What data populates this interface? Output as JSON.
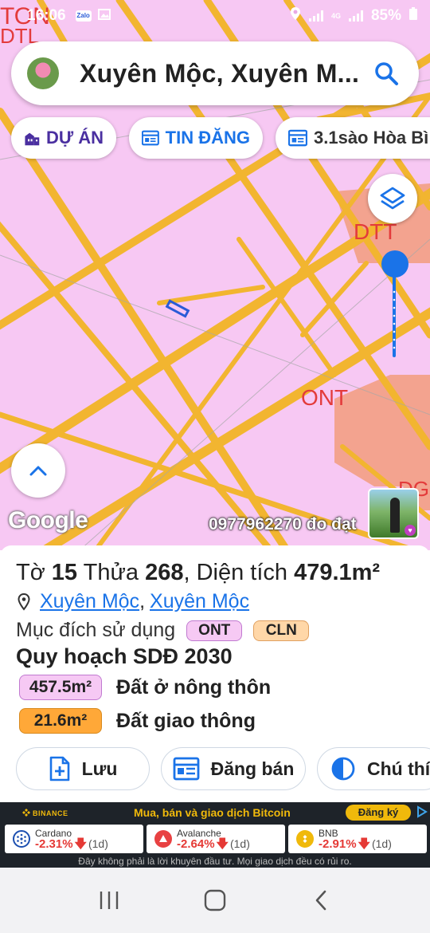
{
  "status_bar": {
    "time": "16:06",
    "app_icon_label": "Zalo",
    "network": "4G",
    "battery": "85%"
  },
  "search": {
    "title": "Xuyên Mộc, Xuyên M..."
  },
  "chips": {
    "du_an": "DỰ ÁN",
    "tin_dang": "TIN ĐĂNG",
    "sao": "3.1sào Hòa Bì"
  },
  "map": {
    "labels": [
      "TON",
      "DTL",
      "DTT",
      "ONT",
      "DG"
    ],
    "google_label": "Google",
    "phone_label": "0977962270 đo đạt"
  },
  "parcel": {
    "to_label": "Tờ",
    "to_value": "15",
    "thua_label": "Thửa",
    "thua_value": "268",
    "dien_tich_label": ", Diện tích",
    "dien_tich_value": "479.1m²",
    "location_1": "Xuyên Mộc",
    "location_sep": ",",
    "location_2": "Xuyên Mộc",
    "purpose_label": "Mục đích sử dụng",
    "tags": [
      "ONT",
      "CLN"
    ],
    "plan_title": "Quy hoạch SDĐ 2030",
    "areas": [
      {
        "value": "457.5m²",
        "label": "Đất ở nông thôn",
        "color": "#f6c9f4"
      },
      {
        "value": "21.6m²",
        "label": "Đất giao thông",
        "color": "#ffa838"
      }
    ]
  },
  "actions": {
    "luu": "Lưu",
    "dang_ban": "Đăng bán",
    "chu_thich": "Chú thí"
  },
  "ad": {
    "brand": "BINANCE",
    "headline": "Mua, bán và giao dịch Bitcoin",
    "signup": "Đăng ký",
    "coins": [
      {
        "name": "Cardano",
        "change": "-2.31%",
        "period": "(1d)",
        "color": "#1c4fb0"
      },
      {
        "name": "Avalanche",
        "change": "-2.64%",
        "period": "(1d)",
        "color": "#e84142"
      },
      {
        "name": "BNB",
        "change": "-2.91%",
        "period": "(1d)",
        "color": "#f0b90b"
      }
    ],
    "disclaimer": "Đây không phải là lời khuyên đầu tư. Mọi giao dịch đều có rủi ro."
  },
  "colors": {
    "accent": "#1a73e8",
    "map_bg": "#f7c8f3",
    "road": "#f2b530"
  }
}
